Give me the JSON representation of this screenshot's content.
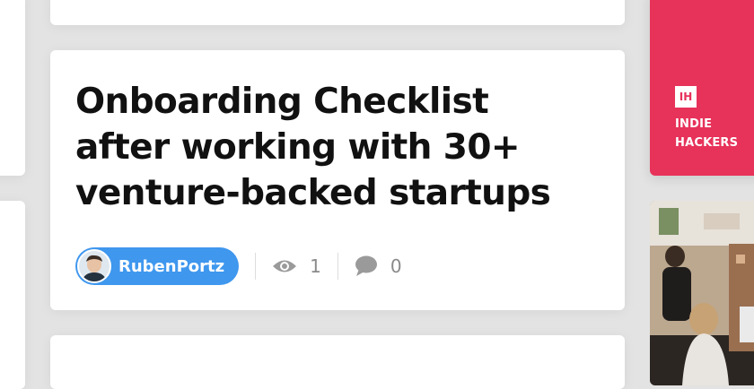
{
  "post": {
    "title": "Onboarding Checklist after working with 30+ venture-backed startups",
    "author": "RubenPortz",
    "views": "1",
    "comments": "0"
  },
  "sidebar": {
    "logo_text": "IH",
    "brand_line1": "INDIE",
    "brand_line2": "HACKERS"
  },
  "icons": {
    "views": "eye-icon",
    "comments": "speech-bubble-icon"
  },
  "colors": {
    "author_pill": "#3f97ee",
    "brand": "#e7325a",
    "title": "#111111",
    "stat": "#8a8a8a"
  }
}
